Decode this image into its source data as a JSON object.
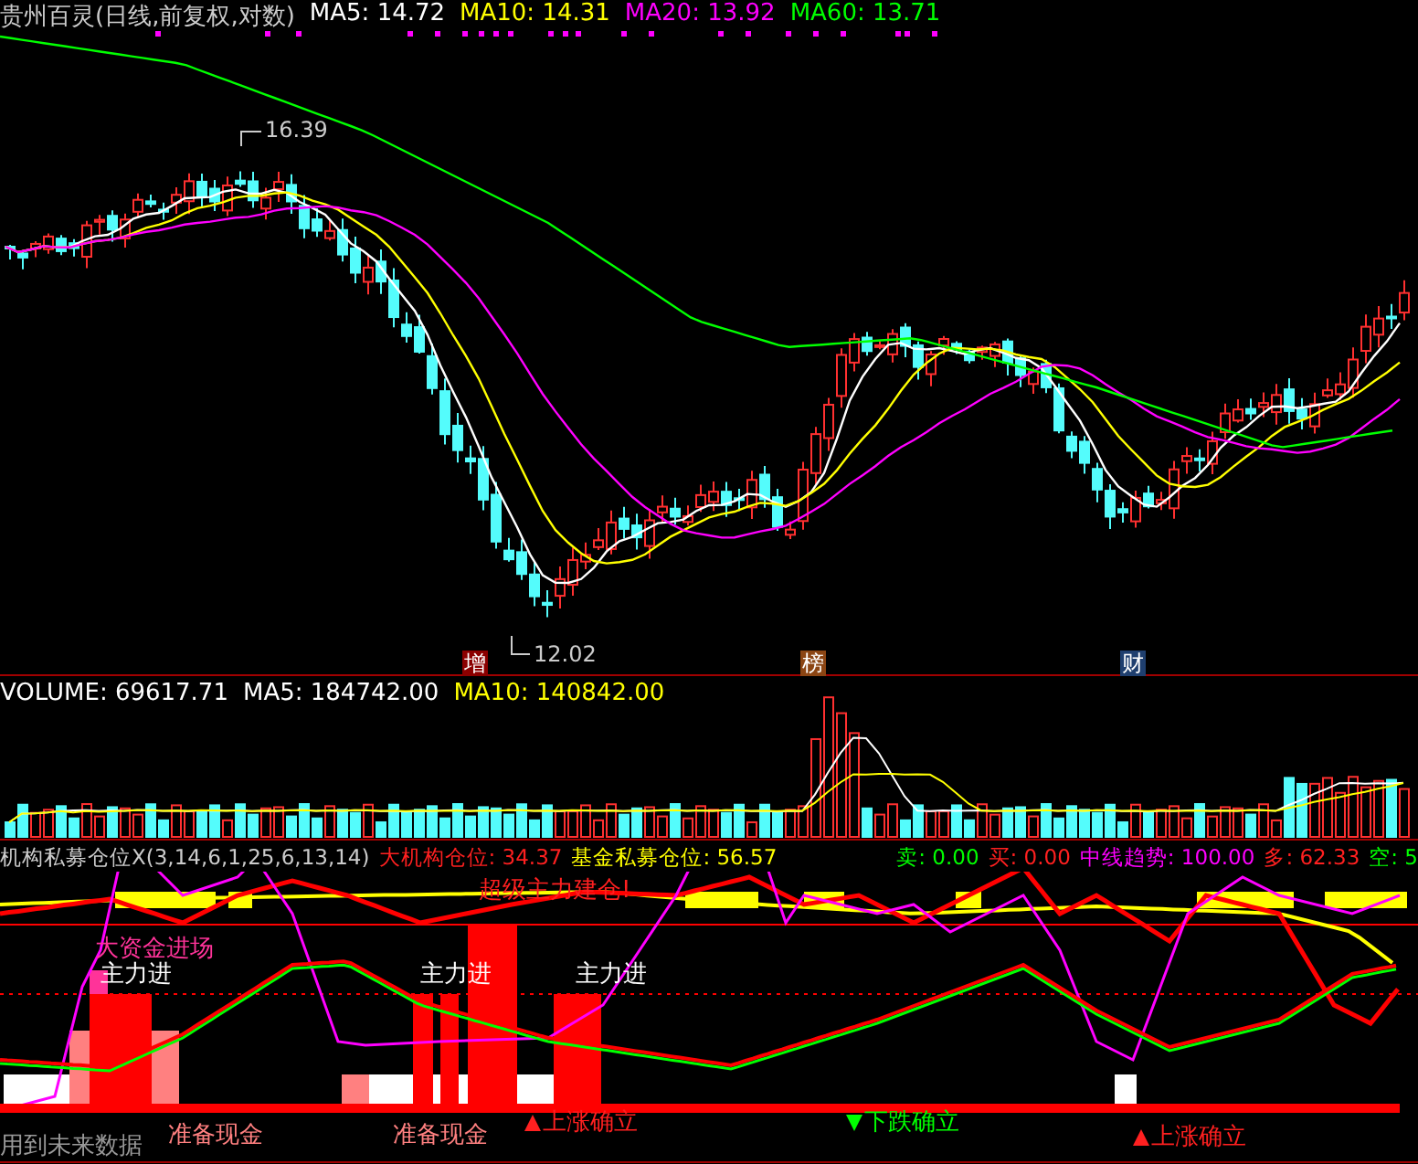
{
  "price_panel": {
    "title": "贵州百灵(日线,前复权,对数)",
    "indicators": [
      {
        "name": "MA5:",
        "value": "14.72",
        "color": "#ffffff"
      },
      {
        "name": "MA10:",
        "value": "14.31",
        "color": "#ffff00"
      },
      {
        "name": "MA20:",
        "value": "13.92",
        "color": "#ff00ff"
      },
      {
        "name": "MA60:",
        "value": "13.71",
        "color": "#00ff00"
      }
    ],
    "high_marker": "16.39",
    "low_marker": "12.02",
    "event_badges": [
      {
        "label": "增",
        "color": "#8b0000"
      },
      {
        "label": "榜",
        "color": "#8b4513"
      },
      {
        "label": "财",
        "color": "#1f3f6f"
      }
    ]
  },
  "volume_panel": {
    "indicators": [
      {
        "name": "VOLUME:",
        "value": "69617.71",
        "color": "#ffffff"
      },
      {
        "name": "MA5:",
        "value": "184742.00",
        "color": "#ffffff"
      },
      {
        "name": "MA10:",
        "value": "140842.00",
        "color": "#ffff00"
      }
    ]
  },
  "indicator_panel": {
    "title": "机构私募仓位X(3,14,6,1,25,6,13,14)",
    "readings": [
      {
        "name": "大机构仓位:",
        "value": "34.37",
        "color": "#ff2020"
      },
      {
        "name": "基金私募仓位:",
        "value": "56.57",
        "color": "#ffff00"
      },
      {
        "name": "卖:",
        "value": "0.00",
        "color": "#00ff00"
      },
      {
        "name": "买:",
        "value": "0.00",
        "color": "#ff2020"
      },
      {
        "name": "中线趋势:",
        "value": "100.00",
        "color": "#ff00ff"
      },
      {
        "name": "多:",
        "value": "62.33",
        "color": "#ff2020"
      },
      {
        "name": "空:",
        "value": "5",
        "color": "#00ff00"
      }
    ],
    "labels": [
      {
        "text": "超级主力建仓!",
        "kind": "plain",
        "color": "#ff2020"
      },
      {
        "text": "大资金进场",
        "kind": "plain",
        "color": "#ff3399"
      },
      {
        "text": "主力进",
        "kind": "plain",
        "color": "#ffffff"
      },
      {
        "text": "主力进",
        "kind": "plain",
        "color": "#ffffff"
      },
      {
        "text": "主力进",
        "kind": "plain",
        "color": "#ffffff"
      },
      {
        "text": "准备现金",
        "kind": "plain",
        "color": "#ff8080"
      },
      {
        "text": "准备现金",
        "kind": "plain",
        "color": "#ff8080"
      },
      {
        "text": "上涨确立",
        "kind": "up",
        "color": "#ff2020"
      },
      {
        "text": "下跌确立",
        "kind": "down",
        "color": "#00ff00"
      },
      {
        "text": "上涨确立",
        "kind": "up",
        "color": "#ff2020"
      }
    ],
    "footer": "用到未来数据"
  }
}
